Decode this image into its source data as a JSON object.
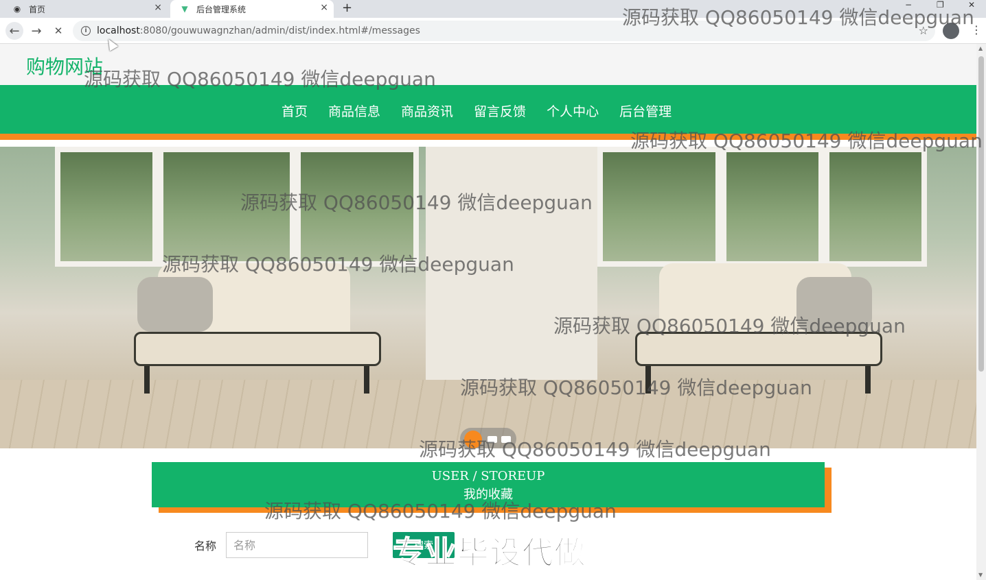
{
  "browser": {
    "tabs": [
      {
        "title": "首页",
        "close": "×"
      },
      {
        "title": "后台管理系统",
        "close": "×"
      }
    ],
    "new_tab": "+",
    "url_host": "localhost",
    "url_rest": ":8080/gouwuwagnzhan/admin/dist/index.html#/messages",
    "back": "←",
    "forward": "→",
    "reload": "✕",
    "star": "☆",
    "menu": "⋮",
    "window_min": "−",
    "window_max": "❐",
    "window_close": "✕"
  },
  "site": {
    "logo": "购物网站",
    "nav": [
      "首页",
      "商品信息",
      "商品资讯",
      "留言反馈",
      "个人中心",
      "后台管理"
    ]
  },
  "section": {
    "title_en": "USER / STOREUP",
    "title_cn": "我的收藏"
  },
  "search": {
    "label": "名称",
    "placeholder": "名称",
    "button": "搜索"
  },
  "watermark": "源码获取 QQ86050149 微信deepguan",
  "stamp": "专业毕设代做",
  "colors": {
    "brand_green": "#13b36a",
    "accent_orange": "#f7891e"
  }
}
